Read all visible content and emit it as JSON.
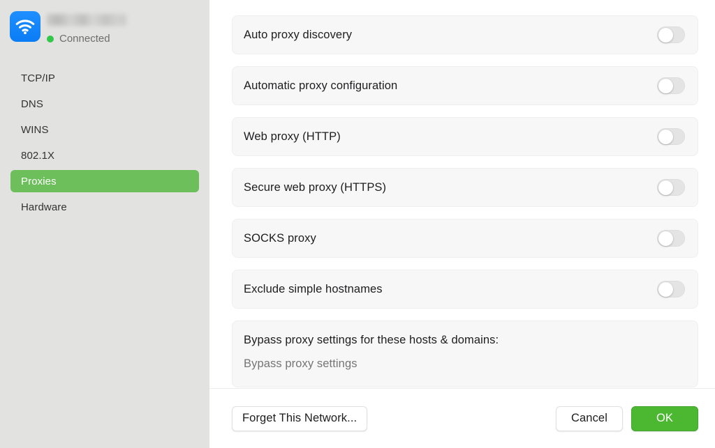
{
  "sidebar": {
    "network": {
      "icon": "wifi-icon",
      "name_redacted": "",
      "status_label": "Connected",
      "status_color": "#34c84a"
    },
    "items": [
      {
        "label": "TCP/IP",
        "selected": false
      },
      {
        "label": "DNS",
        "selected": false
      },
      {
        "label": "WINS",
        "selected": false
      },
      {
        "label": "802.1X",
        "selected": false
      },
      {
        "label": "Proxies",
        "selected": true
      },
      {
        "label": "Hardware",
        "selected": false
      }
    ],
    "selected_color": "#6cbf5a",
    "background_color": "#e2e2e0"
  },
  "main": {
    "proxy_rows": [
      {
        "label": "Auto proxy discovery",
        "enabled": false
      },
      {
        "label": "Automatic proxy configuration",
        "enabled": false
      },
      {
        "label": "Web proxy (HTTP)",
        "enabled": false
      },
      {
        "label": "Secure web proxy (HTTPS)",
        "enabled": false
      },
      {
        "label": "SOCKS proxy",
        "enabled": false
      },
      {
        "label": "Exclude simple hostnames",
        "enabled": false
      }
    ],
    "bypass": {
      "title": "Bypass proxy settings for these hosts & domains:",
      "value": "",
      "placeholder": "Bypass proxy settings"
    }
  },
  "footer": {
    "forget_label": "Forget This Network...",
    "cancel_label": "Cancel",
    "ok_label": "OK",
    "accent_color": "#4cb832"
  }
}
